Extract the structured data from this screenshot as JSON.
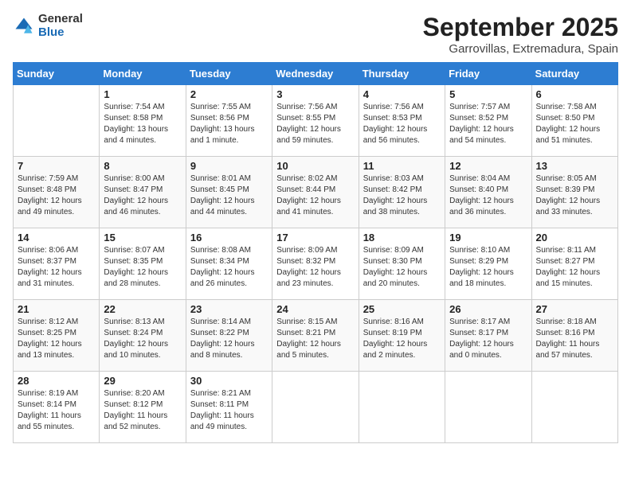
{
  "logo": {
    "general": "General",
    "blue": "Blue"
  },
  "title": "September 2025",
  "location": "Garrovillas, Extremadura, Spain",
  "days_header": [
    "Sunday",
    "Monday",
    "Tuesday",
    "Wednesday",
    "Thursday",
    "Friday",
    "Saturday"
  ],
  "weeks": [
    [
      {
        "day": "",
        "sunrise": "",
        "sunset": "",
        "daylight": ""
      },
      {
        "day": "1",
        "sunrise": "Sunrise: 7:54 AM",
        "sunset": "Sunset: 8:58 PM",
        "daylight": "Daylight: 13 hours and 4 minutes."
      },
      {
        "day": "2",
        "sunrise": "Sunrise: 7:55 AM",
        "sunset": "Sunset: 8:56 PM",
        "daylight": "Daylight: 13 hours and 1 minute."
      },
      {
        "day": "3",
        "sunrise": "Sunrise: 7:56 AM",
        "sunset": "Sunset: 8:55 PM",
        "daylight": "Daylight: 12 hours and 59 minutes."
      },
      {
        "day": "4",
        "sunrise": "Sunrise: 7:56 AM",
        "sunset": "Sunset: 8:53 PM",
        "daylight": "Daylight: 12 hours and 56 minutes."
      },
      {
        "day": "5",
        "sunrise": "Sunrise: 7:57 AM",
        "sunset": "Sunset: 8:52 PM",
        "daylight": "Daylight: 12 hours and 54 minutes."
      },
      {
        "day": "6",
        "sunrise": "Sunrise: 7:58 AM",
        "sunset": "Sunset: 8:50 PM",
        "daylight": "Daylight: 12 hours and 51 minutes."
      }
    ],
    [
      {
        "day": "7",
        "sunrise": "Sunrise: 7:59 AM",
        "sunset": "Sunset: 8:48 PM",
        "daylight": "Daylight: 12 hours and 49 minutes."
      },
      {
        "day": "8",
        "sunrise": "Sunrise: 8:00 AM",
        "sunset": "Sunset: 8:47 PM",
        "daylight": "Daylight: 12 hours and 46 minutes."
      },
      {
        "day": "9",
        "sunrise": "Sunrise: 8:01 AM",
        "sunset": "Sunset: 8:45 PM",
        "daylight": "Daylight: 12 hours and 44 minutes."
      },
      {
        "day": "10",
        "sunrise": "Sunrise: 8:02 AM",
        "sunset": "Sunset: 8:44 PM",
        "daylight": "Daylight: 12 hours and 41 minutes."
      },
      {
        "day": "11",
        "sunrise": "Sunrise: 8:03 AM",
        "sunset": "Sunset: 8:42 PM",
        "daylight": "Daylight: 12 hours and 38 minutes."
      },
      {
        "day": "12",
        "sunrise": "Sunrise: 8:04 AM",
        "sunset": "Sunset: 8:40 PM",
        "daylight": "Daylight: 12 hours and 36 minutes."
      },
      {
        "day": "13",
        "sunrise": "Sunrise: 8:05 AM",
        "sunset": "Sunset: 8:39 PM",
        "daylight": "Daylight: 12 hours and 33 minutes."
      }
    ],
    [
      {
        "day": "14",
        "sunrise": "Sunrise: 8:06 AM",
        "sunset": "Sunset: 8:37 PM",
        "daylight": "Daylight: 12 hours and 31 minutes."
      },
      {
        "day": "15",
        "sunrise": "Sunrise: 8:07 AM",
        "sunset": "Sunset: 8:35 PM",
        "daylight": "Daylight: 12 hours and 28 minutes."
      },
      {
        "day": "16",
        "sunrise": "Sunrise: 8:08 AM",
        "sunset": "Sunset: 8:34 PM",
        "daylight": "Daylight: 12 hours and 26 minutes."
      },
      {
        "day": "17",
        "sunrise": "Sunrise: 8:09 AM",
        "sunset": "Sunset: 8:32 PM",
        "daylight": "Daylight: 12 hours and 23 minutes."
      },
      {
        "day": "18",
        "sunrise": "Sunrise: 8:09 AM",
        "sunset": "Sunset: 8:30 PM",
        "daylight": "Daylight: 12 hours and 20 minutes."
      },
      {
        "day": "19",
        "sunrise": "Sunrise: 8:10 AM",
        "sunset": "Sunset: 8:29 PM",
        "daylight": "Daylight: 12 hours and 18 minutes."
      },
      {
        "day": "20",
        "sunrise": "Sunrise: 8:11 AM",
        "sunset": "Sunset: 8:27 PM",
        "daylight": "Daylight: 12 hours and 15 minutes."
      }
    ],
    [
      {
        "day": "21",
        "sunrise": "Sunrise: 8:12 AM",
        "sunset": "Sunset: 8:25 PM",
        "daylight": "Daylight: 12 hours and 13 minutes."
      },
      {
        "day": "22",
        "sunrise": "Sunrise: 8:13 AM",
        "sunset": "Sunset: 8:24 PM",
        "daylight": "Daylight: 12 hours and 10 minutes."
      },
      {
        "day": "23",
        "sunrise": "Sunrise: 8:14 AM",
        "sunset": "Sunset: 8:22 PM",
        "daylight": "Daylight: 12 hours and 8 minutes."
      },
      {
        "day": "24",
        "sunrise": "Sunrise: 8:15 AM",
        "sunset": "Sunset: 8:21 PM",
        "daylight": "Daylight: 12 hours and 5 minutes."
      },
      {
        "day": "25",
        "sunrise": "Sunrise: 8:16 AM",
        "sunset": "Sunset: 8:19 PM",
        "daylight": "Daylight: 12 hours and 2 minutes."
      },
      {
        "day": "26",
        "sunrise": "Sunrise: 8:17 AM",
        "sunset": "Sunset: 8:17 PM",
        "daylight": "Daylight: 12 hours and 0 minutes."
      },
      {
        "day": "27",
        "sunrise": "Sunrise: 8:18 AM",
        "sunset": "Sunset: 8:16 PM",
        "daylight": "Daylight: 11 hours and 57 minutes."
      }
    ],
    [
      {
        "day": "28",
        "sunrise": "Sunrise: 8:19 AM",
        "sunset": "Sunset: 8:14 PM",
        "daylight": "Daylight: 11 hours and 55 minutes."
      },
      {
        "day": "29",
        "sunrise": "Sunrise: 8:20 AM",
        "sunset": "Sunset: 8:12 PM",
        "daylight": "Daylight: 11 hours and 52 minutes."
      },
      {
        "day": "30",
        "sunrise": "Sunrise: 8:21 AM",
        "sunset": "Sunset: 8:11 PM",
        "daylight": "Daylight: 11 hours and 49 minutes."
      },
      {
        "day": "",
        "sunrise": "",
        "sunset": "",
        "daylight": ""
      },
      {
        "day": "",
        "sunrise": "",
        "sunset": "",
        "daylight": ""
      },
      {
        "day": "",
        "sunrise": "",
        "sunset": "",
        "daylight": ""
      },
      {
        "day": "",
        "sunrise": "",
        "sunset": "",
        "daylight": ""
      }
    ]
  ]
}
